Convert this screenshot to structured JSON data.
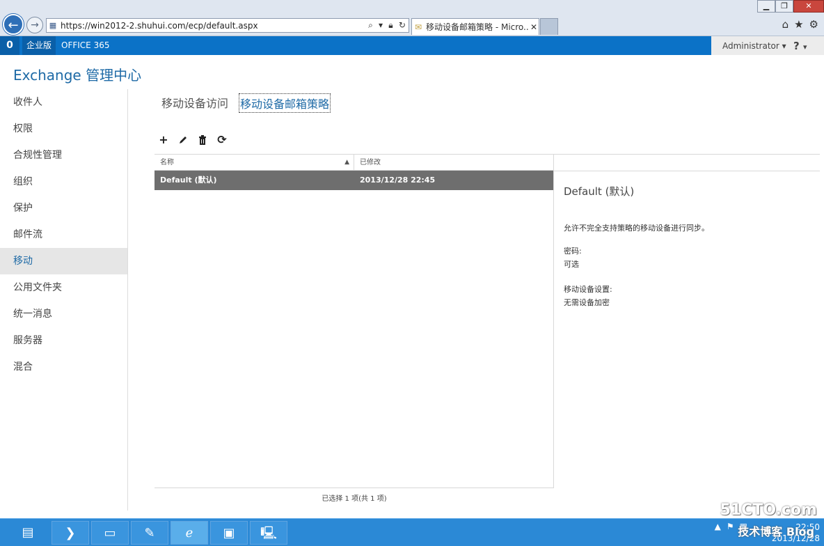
{
  "browser": {
    "url": "https://win2012-2.shuhui.com/ecp/default.aspx",
    "tab_title": "移动设备邮箱策略 - Micro...",
    "minimize": "▁",
    "restore": "❐",
    "close": "✕"
  },
  "appbar": {
    "logo": "0",
    "enterprise": "企业版",
    "office365": "OFFICE 365",
    "user": "Administrator",
    "help": "?"
  },
  "app": {
    "title": "Exchange 管理中心"
  },
  "sidebar": {
    "items": [
      {
        "label": "收件人"
      },
      {
        "label": "权限"
      },
      {
        "label": "合规性管理"
      },
      {
        "label": "组织"
      },
      {
        "label": "保护"
      },
      {
        "label": "邮件流"
      },
      {
        "label": "移动"
      },
      {
        "label": "公用文件夹"
      },
      {
        "label": "统一消息"
      },
      {
        "label": "服务器"
      },
      {
        "label": "混合"
      }
    ],
    "selected": "移动"
  },
  "subtabs": {
    "access": "移动设备访问",
    "policies": "移动设备邮箱策略"
  },
  "toolbar": {
    "add_icon": "plus-icon",
    "edit_icon": "pencil-icon",
    "delete_icon": "trash-icon",
    "refresh_icon": "refresh-icon"
  },
  "list": {
    "columns": {
      "name": "名称",
      "modified": "已修改"
    },
    "rows": [
      {
        "name": "Default (默认)",
        "modified": "2013/12/28 22:45"
      }
    ],
    "footer": "已选择 1 项(共 1 项)"
  },
  "detail": {
    "title": "Default (默认)",
    "description": "允许不完全支持策略的移动设备进行同步。",
    "password_label": "密码:",
    "password_value": "可选",
    "device_label": "移动设备设置:",
    "device_value": "无需设备加密"
  },
  "taskbar": {
    "clock_time": "22:50",
    "clock_date": "2013/12/28"
  },
  "watermark": {
    "site": "51CTO.com",
    "blog": "技术博客 Blog"
  },
  "colors": {
    "accent": "#0b72c7",
    "title_blue": "#1e6aa6",
    "selected_row": "#6e6e6e"
  }
}
